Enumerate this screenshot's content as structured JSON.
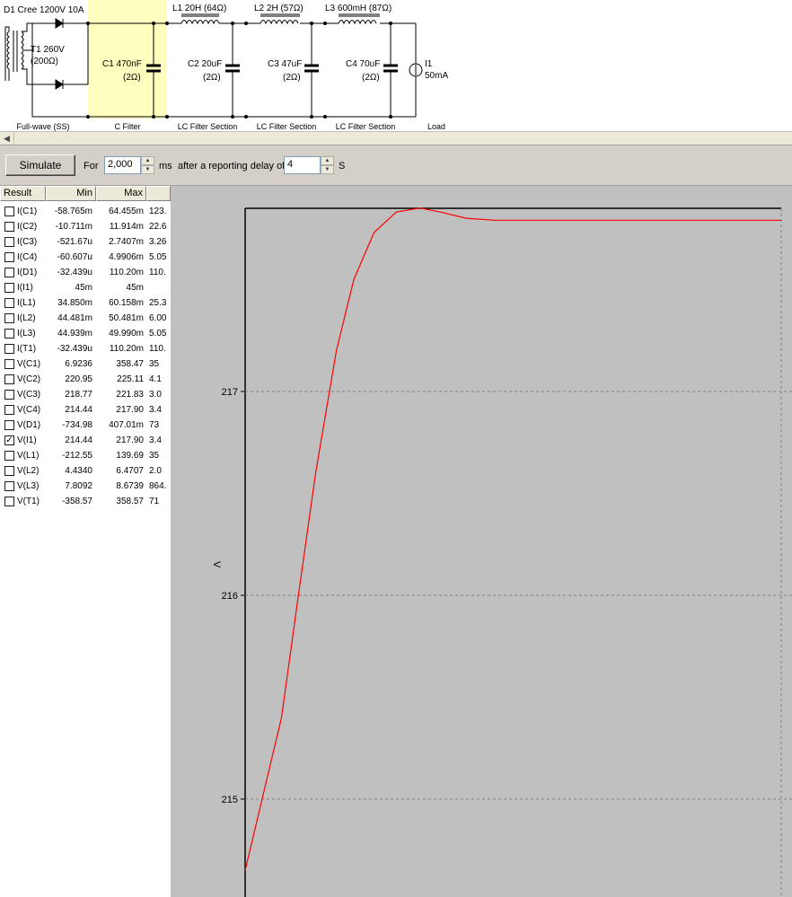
{
  "schematic": {
    "components": {
      "d1": "D1 Cree 1200V 10A",
      "t1_name": "T1 260V",
      "t1_res": "(200Ω)",
      "c1_name": "C1 470nF",
      "c1_res": "(2Ω)",
      "l1": "L1 20H (64Ω)",
      "c2_name": "C2 20uF",
      "c2_res": "(2Ω)",
      "l2": "L2 2H (57Ω)",
      "c3_name": "C3 47uF",
      "c3_res": "(2Ω)",
      "l3": "L3 600mH (87Ω)",
      "c4_name": "C4 70uF",
      "c4_res": "(2Ω)",
      "i1_name": "I1",
      "i1_val": "50mA"
    },
    "sections": [
      "Full-wave (SS)",
      "C Filter",
      "LC Filter Section",
      "LC Filter Section",
      "LC Filter Section",
      "Load"
    ],
    "highlight_color": "#ffffc0"
  },
  "toolbar": {
    "simulate_label": "Simulate",
    "for_label": "For",
    "duration_value": "2,000",
    "ms_label": "ms",
    "delay_label": "after a reporting delay of",
    "delay_value": "4",
    "s_label": "S"
  },
  "results": {
    "headers": [
      "Result",
      "Min",
      "Max"
    ],
    "rows": [
      {
        "name": "I(C1)",
        "min": "-58.765m",
        "max": "64.455m",
        "range": "123.",
        "checked": false
      },
      {
        "name": "I(C2)",
        "min": "-10.711m",
        "max": "11.914m",
        "range": "22.6",
        "checked": false
      },
      {
        "name": "I(C3)",
        "min": "-521.67u",
        "max": "2.7407m",
        "range": "3.26",
        "checked": false
      },
      {
        "name": "I(C4)",
        "min": "-60.607u",
        "max": "4.9906m",
        "range": "5.05",
        "checked": false
      },
      {
        "name": "I(D1)",
        "min": "-32.439u",
        "max": "110.20m",
        "range": "110.",
        "checked": false
      },
      {
        "name": "I(I1)",
        "min": "45m",
        "max": "45m",
        "range": "",
        "checked": false
      },
      {
        "name": "I(L1)",
        "min": "34.850m",
        "max": "60.158m",
        "range": "25.3",
        "checked": false
      },
      {
        "name": "I(L2)",
        "min": "44.481m",
        "max": "50.481m",
        "range": "6.00",
        "checked": false
      },
      {
        "name": "I(L3)",
        "min": "44.939m",
        "max": "49.990m",
        "range": "5.05",
        "checked": false
      },
      {
        "name": "I(T1)",
        "min": "-32.439u",
        "max": "110.20m",
        "range": "110.",
        "checked": false
      },
      {
        "name": "V(C1)",
        "min": "6.9236",
        "max": "358.47",
        "range": "35",
        "checked": false
      },
      {
        "name": "V(C2)",
        "min": "220.95",
        "max": "225.11",
        "range": "4.1",
        "checked": false
      },
      {
        "name": "V(C3)",
        "min": "218.77",
        "max": "221.83",
        "range": "3.0",
        "checked": false
      },
      {
        "name": "V(C4)",
        "min": "214.44",
        "max": "217.90",
        "range": "3.4",
        "checked": false
      },
      {
        "name": "V(D1)",
        "min": "-734.98",
        "max": "407.01m",
        "range": "73",
        "checked": false
      },
      {
        "name": "V(I1)",
        "min": "214.44",
        "max": "217.90",
        "range": "3.4",
        "checked": true
      },
      {
        "name": "V(L1)",
        "min": "-212.55",
        "max": "139.69",
        "range": "35",
        "checked": false
      },
      {
        "name": "V(L2)",
        "min": "4.4340",
        "max": "6.4707",
        "range": "2.0",
        "checked": false
      },
      {
        "name": "V(L3)",
        "min": "7.8092",
        "max": "8.6739",
        "range": "864.",
        "checked": false
      },
      {
        "name": "V(T1)",
        "min": "-358.57",
        "max": "358.57",
        "range": "71",
        "checked": false
      }
    ]
  },
  "chart_data": {
    "type": "line",
    "ylabel": "V",
    "yticks": [
      217,
      216,
      215
    ],
    "ylim": [
      214.65,
      217.9
    ],
    "series": [
      {
        "values_x_ms": [
          0,
          15,
          30,
          50,
          80,
          110,
          150,
          200,
          260,
          320,
          400,
          500,
          600,
          800,
          1000,
          1300,
          1700,
          2000
        ],
        "values_y": [
          214.65,
          215.4,
          216.0,
          216.6,
          217.2,
          217.55,
          217.78,
          217.88,
          217.9,
          217.88,
          217.85,
          217.84,
          217.84,
          217.84,
          217.84,
          217.84,
          217.84,
          217.84
        ],
        "color": "#ff0000"
      }
    ],
    "grid": true,
    "background": "#c0c0c0"
  }
}
